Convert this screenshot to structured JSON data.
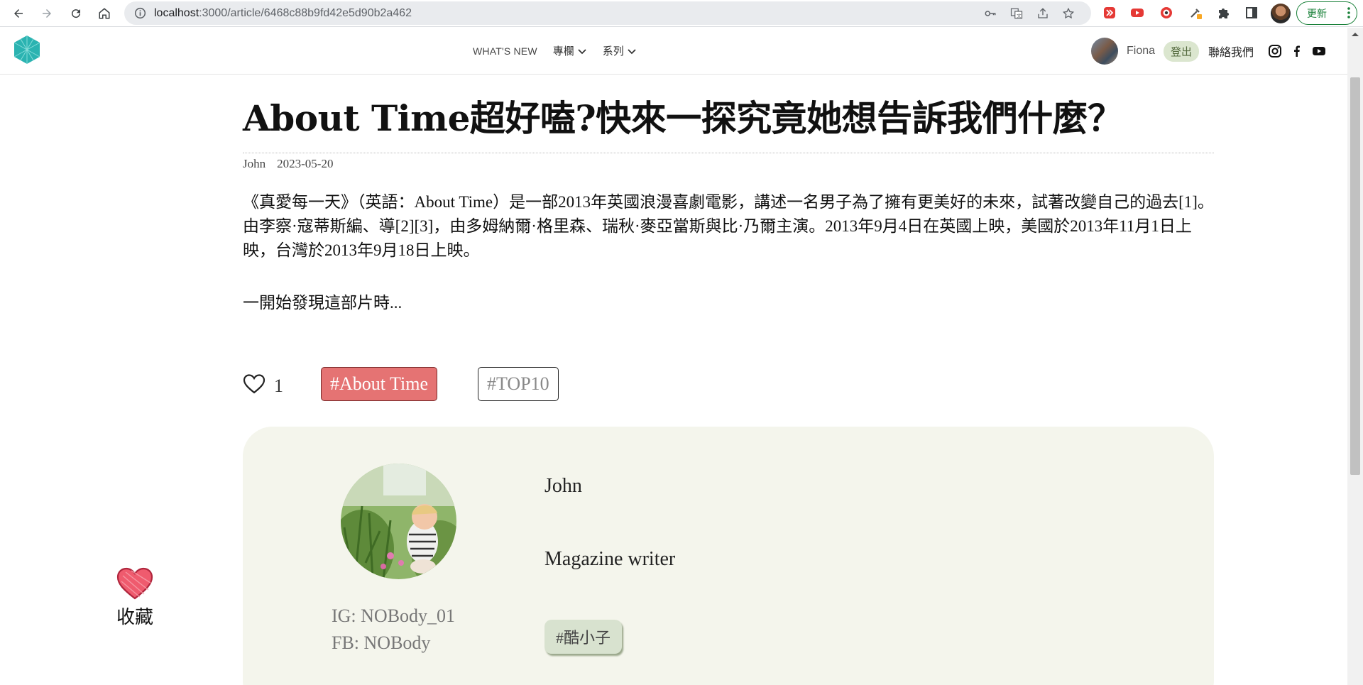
{
  "browser": {
    "url_host": "localhost",
    "url_path": ":3000/article/6468c88b9fd42e5d90b2a462",
    "update_label": "更新"
  },
  "header": {
    "menu": [
      {
        "label": "WHAT'S NEW",
        "has_dropdown": false
      },
      {
        "label": "專欄",
        "has_dropdown": true
      },
      {
        "label": "系列",
        "has_dropdown": true
      }
    ],
    "user_name": "Fiona",
    "logout_label": "登出",
    "contact_label": "聯絡我們",
    "social_icons": [
      "instagram-icon",
      "facebook-icon",
      "youtube-icon"
    ]
  },
  "article": {
    "title": "About Time超好嗑?快來一探究竟她想告訴我們什麼？",
    "author": "John",
    "date": "2023-05-20",
    "body": "《真愛每一天》（英語：About Time）是一部2013年英國浪漫喜劇電影，講述一名男子為了擁有更美好的未來，試著改變自己的過去[1]。由李察·寇蒂斯編、導[2][3]，由多姆納爾·格里森、瑞秋·麥亞當斯與比·乃爾主演。2013年9月4日在英國上映，美國於2013年11月1日上映，台灣於2013年9月18日上映。",
    "lead": "一開始發現這部片時...",
    "likes": "1",
    "tags": [
      "#About Time",
      "#TOP10"
    ]
  },
  "author_card": {
    "name": "John",
    "role": "Magazine writer",
    "ig": "IG: NOBody_01",
    "fb": "FB: NOBody",
    "tag": "#酷小子"
  },
  "favorite": {
    "label": "收藏"
  },
  "colors": {
    "brand_teal": "#2bb3b1",
    "tag_active": "#e57373",
    "card_bg": "#f4f5ec",
    "logout_bg": "#dbe6cf",
    "update_green": "#188038"
  }
}
